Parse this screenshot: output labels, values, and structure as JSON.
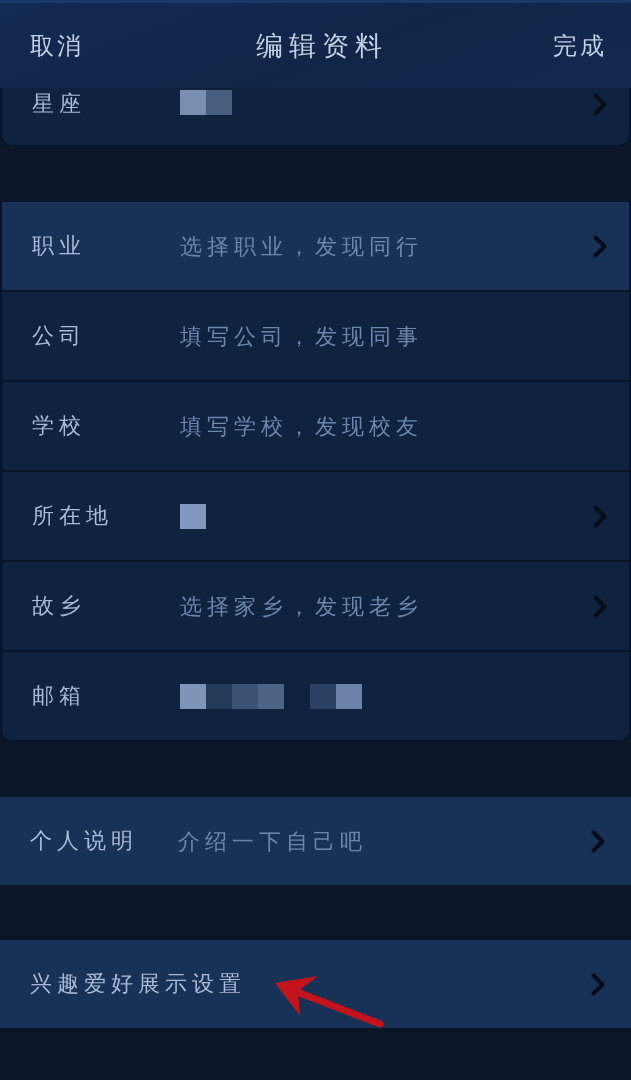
{
  "header": {
    "cancel": "取消",
    "title": "编辑资料",
    "done": "完成"
  },
  "sections": [
    {
      "kind": "card",
      "partial": true,
      "rows": [
        {
          "label": "星座",
          "mosaic": [
            [
              {
                "color": "#7a8fb0"
              },
              {
                "color": "#4a5e80"
              }
            ]
          ],
          "chevron": true,
          "highlighted": false
        }
      ]
    },
    {
      "kind": "card",
      "partial": false,
      "rows": [
        {
          "label": "职业",
          "placeholder": "选择职业，发现同行",
          "chevron": true,
          "highlighted": true
        },
        {
          "label": "公司",
          "placeholder": "填写公司，发现同事",
          "chevron": false,
          "highlighted": false
        },
        {
          "label": "学校",
          "placeholder": "填写学校，发现校友",
          "chevron": false,
          "highlighted": false
        },
        {
          "label": "所在地",
          "mosaic": [
            [
              {
                "color": "#8199c0"
              }
            ]
          ],
          "chevron": true,
          "highlighted": false
        },
        {
          "label": "故乡",
          "placeholder": "选择家乡，发现老乡",
          "chevron": true,
          "highlighted": false
        },
        {
          "label": "邮箱",
          "mosaic": [
            [
              {
                "color": "#7f95b8"
              },
              {
                "color": "#263a5a"
              },
              {
                "color": "#3d5275"
              },
              {
                "color": "#4f6485"
              }
            ],
            [
              {
                "color": "#2b4062"
              },
              {
                "color": "#6b82a6"
              }
            ]
          ],
          "chevron": false,
          "highlighted": false
        }
      ]
    },
    {
      "kind": "plain",
      "partial": false,
      "rows": [
        {
          "label": "个人说明",
          "placeholder": "介绍一下自己吧",
          "chevron": true,
          "highlighted": true
        }
      ]
    },
    {
      "kind": "plain",
      "partial": false,
      "rows": [
        {
          "label": "兴趣爱好展示设置",
          "chevron": true,
          "highlighted": true
        }
      ]
    }
  ]
}
